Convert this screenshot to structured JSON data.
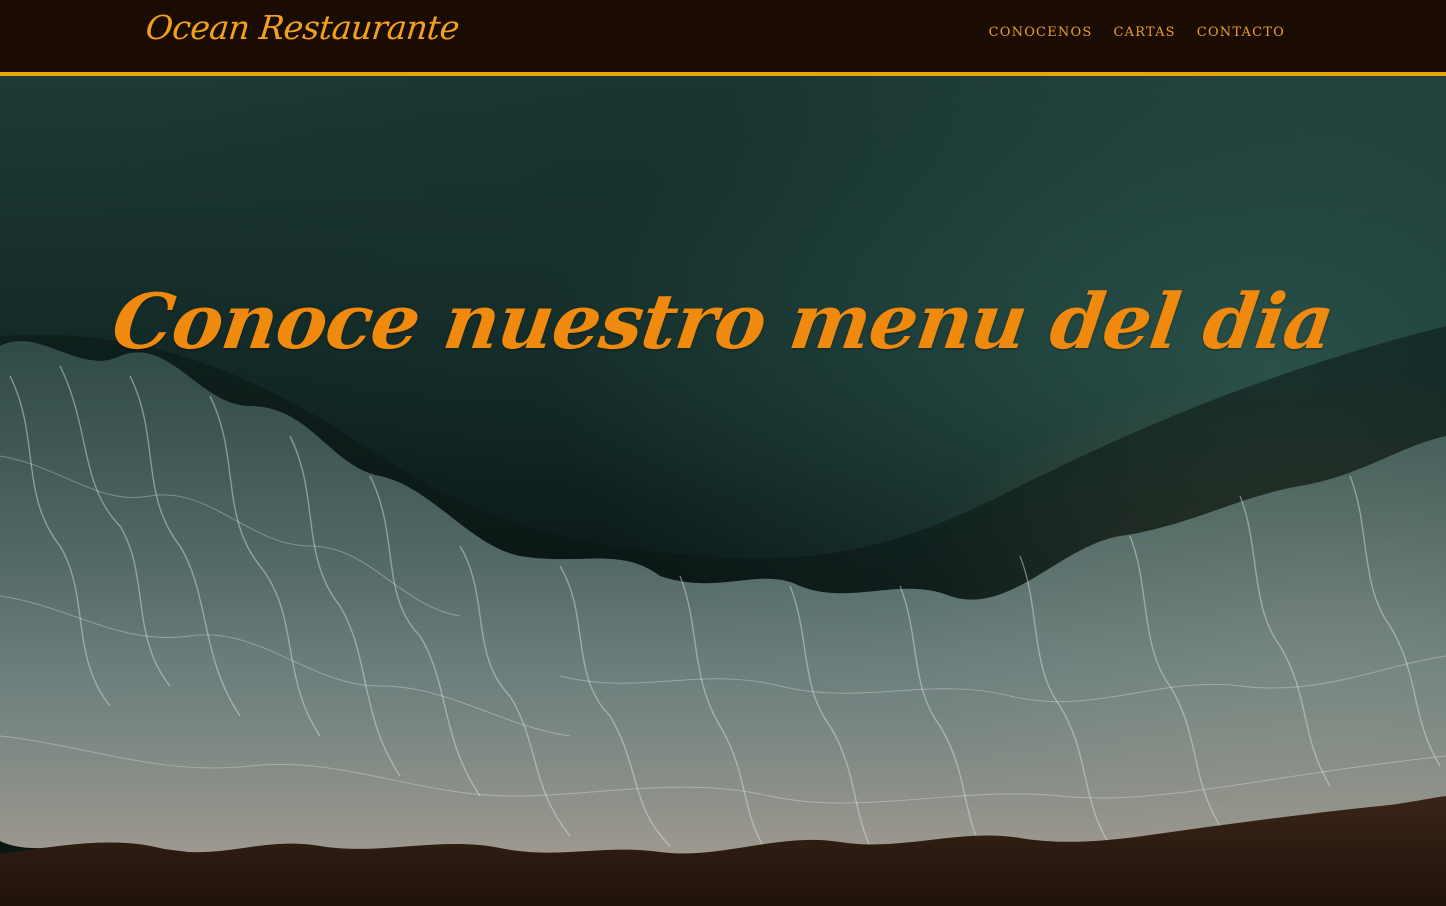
{
  "header": {
    "brand": "Ocean Restaurante",
    "nav": [
      {
        "label": "CONOCENOS"
      },
      {
        "label": "CARTAS"
      },
      {
        "label": "CONTACTO"
      }
    ]
  },
  "hero": {
    "headline": "Conoce nuestro menu del dia"
  },
  "colors": {
    "header_bg": "#1a0b03",
    "accent_border": "#e6a50a",
    "brand_text": "#f0a21c",
    "headline_text": "#ef8a0e"
  }
}
